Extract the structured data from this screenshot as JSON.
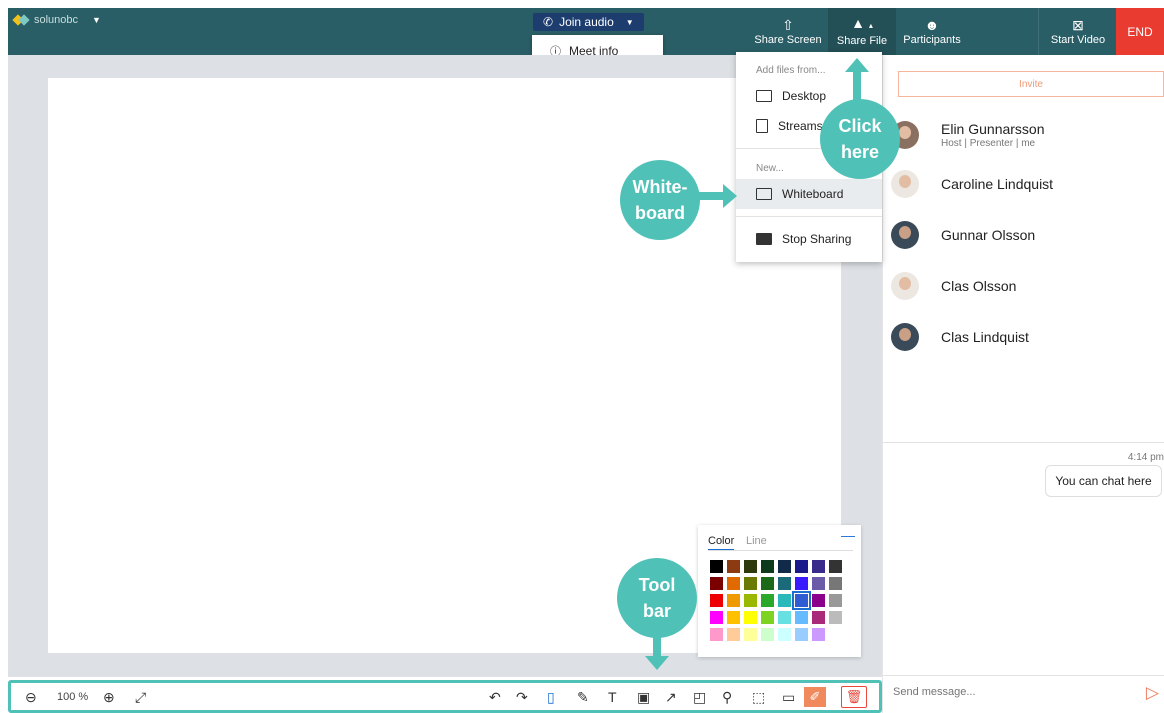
{
  "topbar": {
    "brand": "solunobc",
    "join_audio": "Join audio",
    "share_screen": "Share Screen",
    "share_file": "Share File",
    "participants": "Participants",
    "start_video": "Start Video",
    "end": "END"
  },
  "meet_info": "Meet info",
  "share_menu": {
    "add_files_header": "Add files from...",
    "desktop": "Desktop",
    "streams": "Streams",
    "new_header": "New...",
    "whiteboard": "Whiteboard",
    "stop_sharing": "Stop Sharing"
  },
  "panel": {
    "invite": "Invite",
    "participants": [
      {
        "name": "Elin Gunnarsson",
        "role": "Host | Presenter | me"
      },
      {
        "name": "Caroline Lindquist",
        "role": ""
      },
      {
        "name": "Gunnar Olsson",
        "role": ""
      },
      {
        "name": "Clas Olsson",
        "role": ""
      },
      {
        "name": "Clas Lindquist",
        "role": ""
      }
    ],
    "chat_time": "4:14 pm",
    "chat_message": "You can chat here",
    "send_placeholder": "Send message..."
  },
  "picker": {
    "tab_color": "Color",
    "tab_line": "Line",
    "selected_color": "#2f5bd3",
    "colors": [
      "#000000",
      "#8b3a12",
      "#2e3a0c",
      "#0c3a1a",
      "#122a4a",
      "#1a1a8a",
      "#3a2a8a",
      "#333333",
      "#7a0000",
      "#e06a00",
      "#6a7a00",
      "#1a6a1a",
      "#1a6a7a",
      "#3a1aff",
      "#6a5aa8",
      "#777777",
      "#ee0000",
      "#ee9a00",
      "#9ab800",
      "#2aa82a",
      "#2ab8b8",
      "#2f5bd3",
      "#8a008a",
      "#999999",
      "#ff00ff",
      "#ffc000",
      "#ffff00",
      "#7ed321",
      "#66e0e0",
      "#66bbff",
      "#aa2a7a",
      "#bbbbbb",
      "#ff99cc",
      "#ffcc99",
      "#ffff99",
      "#ccffcc",
      "#ccffff",
      "#99ccff",
      "#cc99ff",
      ""
    ]
  },
  "toolbar": {
    "zoom": "100 %"
  },
  "callouts": {
    "click_here_1": "Click",
    "click_here_2": "here",
    "whiteboard_1": "White-",
    "whiteboard_2": "board",
    "toolbar_1": "Tool",
    "toolbar_2": "bar"
  },
  "icons": {
    "phone": "phone-icon",
    "share_screen": "share-screen-icon",
    "share_file": "share-file-icon",
    "participants": "participants-icon",
    "video_off": "video-off-icon"
  }
}
